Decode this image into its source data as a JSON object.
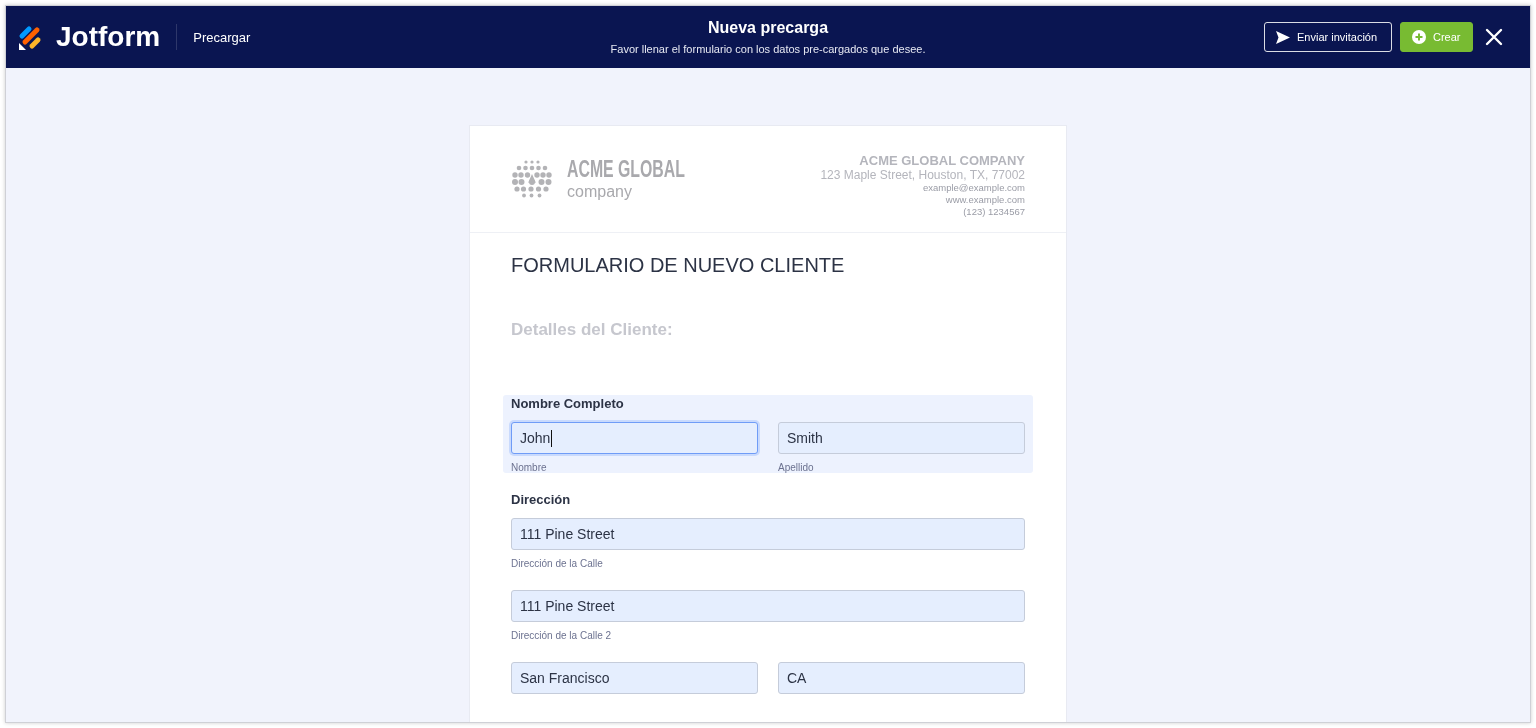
{
  "header": {
    "brand": "Jotform",
    "section": "Precargar",
    "title": "Nueva precarga",
    "subtitle": "Favor llenar el formulario con los datos pre-cargados que desee.",
    "buttons": [
      {
        "kind": "outline",
        "label": "Enviar invitación"
      },
      {
        "kind": "primary",
        "label": "Crear"
      }
    ]
  },
  "form": {
    "logo": {
      "name": "ACME GLOBAL",
      "tagline": "company"
    },
    "company": {
      "name": "ACME GLOBAL COMPANY",
      "address": "123 Maple Street, Houston, TX, 77002",
      "email": "example@example.com",
      "website": "www.example.com",
      "phone": "(123) 1234567"
    },
    "title": "FORMULARIO DE NUEVO CLIENTE",
    "heading": "Detalles del Cliente:",
    "questions": [
      {
        "label": "Nombre Completo",
        "active": true,
        "rows": [
          [
            {
              "value": "John",
              "sublabel": "Nombre",
              "focused": true
            },
            {
              "value": "Smith",
              "sublabel": "Apellido",
              "focused": false
            }
          ]
        ]
      },
      {
        "label": "Dirección",
        "active": false,
        "rows": [
          [
            {
              "value": "111 Pine Street",
              "sublabel": "Dirección de la Calle",
              "focused": false
            }
          ],
          [
            {
              "value": "111 Pine Street",
              "sublabel": "Dirección de la Calle 2",
              "focused": false
            }
          ],
          [
            {
              "value": "San Francisco",
              "focused": false
            },
            {
              "value": "CA",
              "focused": false
            }
          ]
        ]
      }
    ]
  }
}
